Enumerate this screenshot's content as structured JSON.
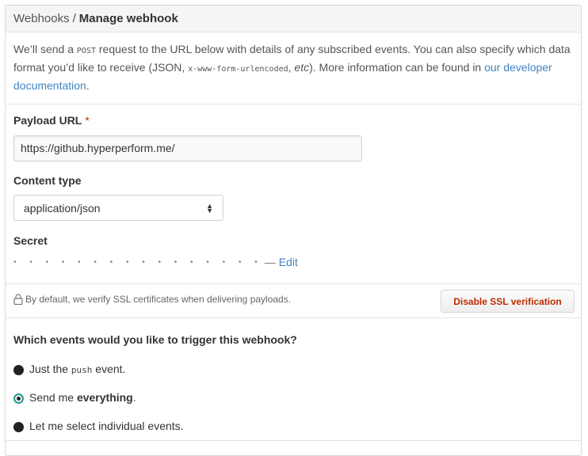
{
  "breadcrumb": {
    "parent": "Webhooks",
    "separator": "/",
    "current": "Manage webhook"
  },
  "intro": {
    "part1": "We’ll send a ",
    "post_code": "POST",
    "part2": " request to the URL below with details of any subscribed events. You can also specify which data format you’d like to receive (JSON, ",
    "form_code": "x-www-form-urlencoded",
    "part3": ", ",
    "etc": "etc",
    "part4": "). More information can be found in ",
    "link_text": "our developer documentation",
    "part5": "."
  },
  "payload": {
    "label": "Payload URL",
    "required_mark": "*",
    "value": "https://github.hyperperform.me/"
  },
  "content_type": {
    "label": "Content type",
    "selected": "application/json"
  },
  "secret": {
    "label": "Secret",
    "masked": "• • • • • • • • • • • • • • • •",
    "dash": "—",
    "edit_label": "Edit"
  },
  "ssl": {
    "note": "By default, we verify SSL certificates when delivering payloads.",
    "button_label": "Disable SSL verification",
    "icon": "lock-icon"
  },
  "events": {
    "question": "Which events would you like to trigger this webhook?",
    "options": [
      {
        "pre": "Just the ",
        "code": "push",
        "post": " event.",
        "checked": false
      },
      {
        "pre": "Send me ",
        "bold": "everything",
        "post": ".",
        "checked": true
      },
      {
        "pre": "Let me select individual events.",
        "checked": false
      }
    ]
  },
  "colors": {
    "link": "#4183c4",
    "danger": "#bd2c00",
    "required": "#bd2c00"
  }
}
